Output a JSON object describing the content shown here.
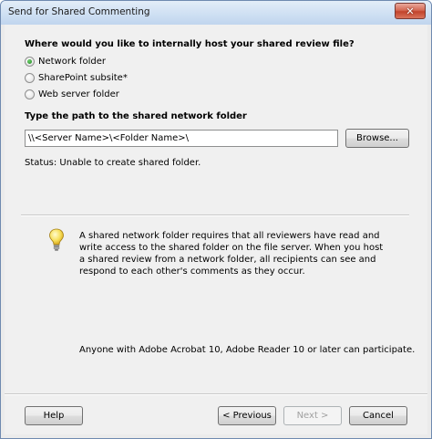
{
  "window": {
    "title": "Send for Shared Commenting",
    "close_label": "✕"
  },
  "question": "Where would you like to internally host your shared review file?",
  "hosting_options": [
    {
      "label": "Network folder",
      "selected": true
    },
    {
      "label": "SharePoint subsite*",
      "selected": false
    },
    {
      "label": "Web server folder",
      "selected": false
    }
  ],
  "path_section": {
    "label": "Type the path to the shared network folder",
    "value": "\\\\<Server Name>\\<Folder Name>\\",
    "browse_label": "Browse..."
  },
  "status": "Status: Unable to create shared folder.",
  "info": {
    "icon": "lightbulb-icon",
    "text": "A shared network folder requires that all reviewers have read and write access to the shared folder on the file server. When you host a shared review from a network folder, all recipients can see and respond to each other's comments as they occur."
  },
  "participate_note": "Anyone with Adobe Acrobat 10, Adobe Reader 10 or later can participate.",
  "buttons": {
    "help": "Help",
    "previous": "< Previous",
    "next": "Next >",
    "cancel": "Cancel"
  },
  "colors": {
    "title_bar": "#cfe0f3",
    "close_button": "#c2442c",
    "dialog_bg": "#f0f0f0",
    "radio_selected": "#1b7f1b"
  }
}
